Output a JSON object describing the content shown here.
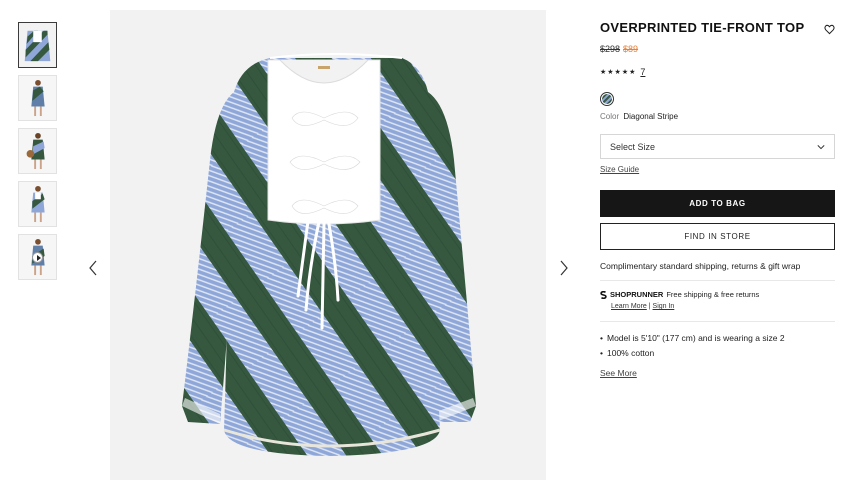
{
  "product": {
    "title": "OVERPRINTED TIE-FRONT TOP",
    "price_original": "$298",
    "price_sale": "$89",
    "rating_stars": "★★★★★",
    "review_count": "7",
    "color_label": "Color",
    "color_value": "Diagonal Stripe"
  },
  "size_select": {
    "selected": "Select Size"
  },
  "links": {
    "size_guide": "Size Guide",
    "see_more": "See More"
  },
  "buttons": {
    "add_to_bag": "ADD TO BAG",
    "find_in_store": "FIND IN STORE"
  },
  "shipping_text": "Complimentary standard shipping, returns & gift wrap",
  "shoprunner": {
    "logo": "SHOPRUNNER",
    "text": "Free shipping & free returns",
    "learn_more": "Learn More",
    "separator": "|",
    "sign_in": "Sign In"
  },
  "details": [
    "Model is 5'10\" (177 cm) and is wearing a size 2",
    "100% cotton"
  ],
  "thumbnails": [
    "front",
    "model-front",
    "model-back",
    "model-side",
    "video"
  ],
  "icons": {
    "heart": "heart-icon",
    "chevron": "chevron-down-icon",
    "prev": "chevron-left-icon",
    "next": "chevron-right-icon",
    "play": "play-icon"
  },
  "colors": {
    "stripe_green": "#35583f",
    "stripe_blue": "#8ea7d8",
    "sale": "#e8803a",
    "button_dark": "#161616"
  }
}
